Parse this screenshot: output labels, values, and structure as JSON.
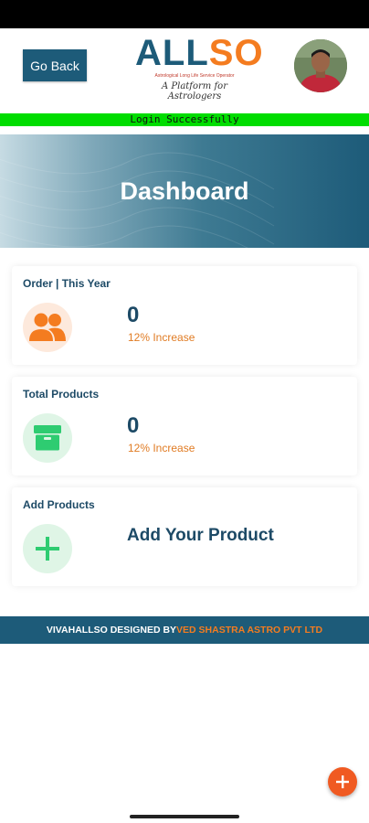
{
  "header": {
    "back_label": "Go Back",
    "logo": {
      "word_part1": "ALL",
      "word_part2": "SO",
      "tagline": "Astrological Long Life Service Operator",
      "subtitle": "A Platform for Astrologers"
    },
    "avatar_icon": "user-photo"
  },
  "status_banner": {
    "text": "Login Successfully",
    "color": "#00dd00"
  },
  "hero": {
    "title": "Dashboard"
  },
  "cards": [
    {
      "title": "Order | This Year",
      "value": "0",
      "trend": "12% Increase",
      "icon": "users-icon",
      "icon_color": "#f47c20"
    },
    {
      "title": "Total Products",
      "value": "0",
      "trend": "12% Increase",
      "icon": "box-icon",
      "icon_color": "#2ecc71"
    },
    {
      "title": "Add Products",
      "action_label": "Add Your Product",
      "icon": "plus-icon",
      "icon_color": "#2ecc71"
    }
  ],
  "footer": {
    "brand": "VIVAHALLSO DESIGNED BY ",
    "company": "VED SHASTRA ASTRO PVT LTD"
  },
  "fab": {
    "icon": "plus-icon",
    "color": "#f05a22"
  },
  "colors": {
    "primary": "#1d5b79",
    "accent": "#f47c20",
    "success": "#00dd00"
  }
}
